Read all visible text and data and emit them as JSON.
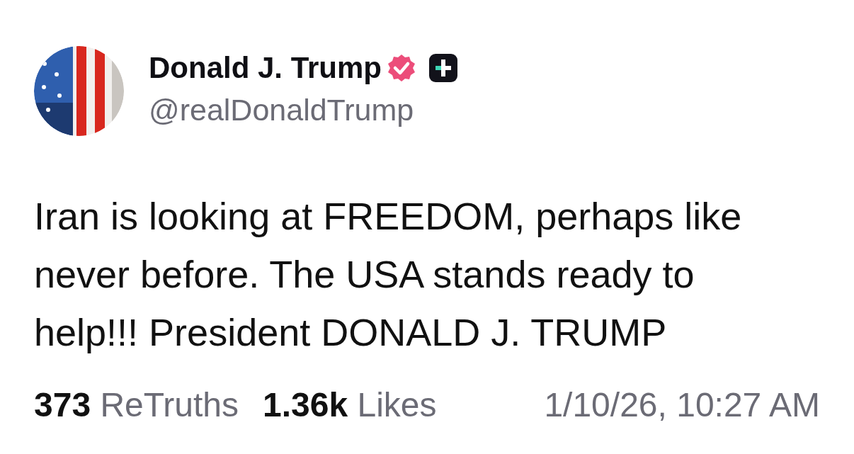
{
  "author": {
    "name": "Donald J. Trump",
    "handle": "@realDonaldTrump",
    "verified": true
  },
  "post": {
    "text": "Iran is looking at FREEDOM, perhaps like never before. The USA stands ready to help!!! President DONALD J. TRUMP"
  },
  "stats": [
    "**373** ReTruths",
    "**1.36k** Likes"
  ],
  "timestamp": "1/10/26, 10:27 AM"
}
